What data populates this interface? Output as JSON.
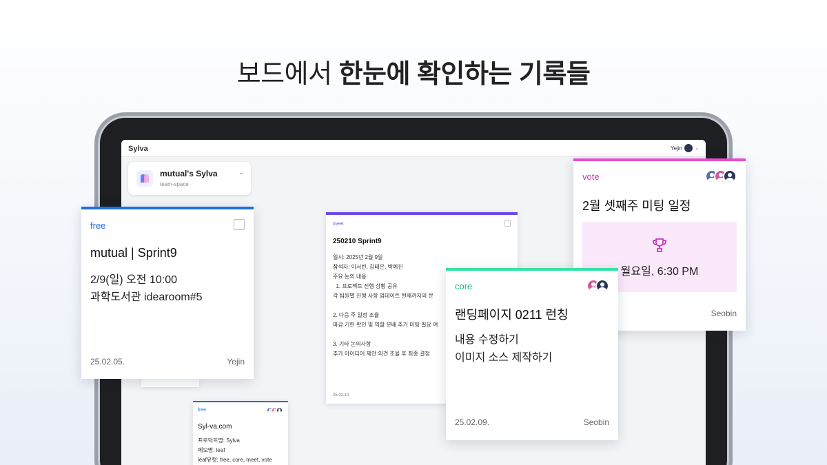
{
  "headline": {
    "light": "보드에서 ",
    "bold": "한눈에 확인하는 기록들"
  },
  "app": {
    "title": "Sylva",
    "user": "Yejin"
  },
  "team": {
    "name": "mutual's Sylva",
    "sub": "team-space"
  },
  "cards": {
    "free": {
      "tag": "free",
      "title": "mutual | Sprint9",
      "line1": "2/9(일) 오전 10:00",
      "line2": "과학도서관 idearoom#5",
      "date": "25.02.05.",
      "author": "Yejin",
      "color": "#1f6fe5"
    },
    "meet": {
      "tag": "meet",
      "title": "250210 Sprint9",
      "lines": [
        "일시: 2025년 2월 9일",
        "참석자: 이서빈, 김태은, 박예진",
        "주요 논의 내용:",
        "  1. 프로젝트 진행 상황 공유",
        "각 팀원별 진행 사항 업데이트 현재까지의 문",
        "",
        "2. 다음 주 일정 조율",
        "마감 기한 확인 및 역할 분배 추가 미팅 필요 여",
        "",
        "3. 기타 논의사항",
        "추가 아이디어 제안 의견 조율 후 최종 결정"
      ],
      "date": "25.02.10.",
      "color": "#6b4ce8"
    },
    "free2": {
      "tag": "free",
      "title": "Syl-va.com",
      "lines": [
        "프로덕트명: Sylva",
        "메모명: leaf",
        "leaf유형: free, core, meet, vote"
      ],
      "color": "#1f6fe5"
    },
    "vote": {
      "tag": "vote",
      "title": "2월 셋째주 미팅 일정",
      "option": "월요일, 6:30 PM",
      "author": "Seobin",
      "color": "#e94bd1"
    },
    "core": {
      "tag": "core",
      "title": "랜딩페이지 0211 런칭",
      "line1": "내용 수정하기",
      "line2": "이미지 소스 제작하기",
      "date": "25.02.09.",
      "author": "Seobin",
      "color": "#37e0a5"
    }
  }
}
